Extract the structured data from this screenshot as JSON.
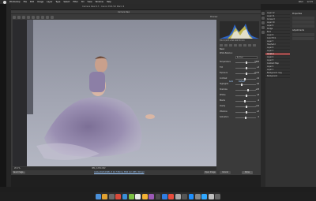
{
  "menubar": {
    "items": [
      "Photoshop",
      "File",
      "Edit",
      "Image",
      "Layer",
      "Type",
      "Select",
      "Filter",
      "3D",
      "View",
      "Window",
      "Help"
    ],
    "right": [
      "Wed",
      "12:15"
    ]
  },
  "ps": {
    "document_title": "Camera Raw 9.7 - Canon EOS 5D Mark III"
  },
  "acr": {
    "title": "Camera Raw",
    "preview_label": "Preview",
    "zoom": "20.1%",
    "filename": "IMG_1234.CR2",
    "footer_info": "Adobe RGB (1998); 8 bit; 5760 by 3840 (22.1MP); 300 ppi",
    "save_button": "Save Image...",
    "open_button": "Open Image",
    "cancel_button": "Cancel",
    "done_button": "Done"
  },
  "panel": {
    "camera_info": "f/4.0  1/125 s  ISO 400  50 mm",
    "header": "Basic",
    "white_balance_label": "White Balance:",
    "white_balance_value": "As Shot",
    "auto_link": "Auto",
    "default_link": "Default",
    "sliders": [
      {
        "label": "Temperature",
        "value": "5200",
        "pos": 0.55
      },
      {
        "label": "Tint",
        "value": "+4",
        "pos": 0.52
      },
      {
        "label": "Exposure",
        "value": "+0.35",
        "pos": 0.53
      },
      {
        "label": "Contrast",
        "value": "-12",
        "pos": 0.45
      },
      {
        "label": "Highlights",
        "value": "-40",
        "pos": 0.32
      },
      {
        "label": "Shadows",
        "value": "+25",
        "pos": 0.62
      },
      {
        "label": "Whites",
        "value": "+8",
        "pos": 0.54
      },
      {
        "label": "Blacks",
        "value": "-6",
        "pos": 0.48
      },
      {
        "label": "Clarity",
        "value": "+10",
        "pos": 0.55
      },
      {
        "label": "Vibrance",
        "value": "+5",
        "pos": 0.52
      },
      {
        "label": "Saturation",
        "value": "0",
        "pos": 0.5
      }
    ]
  },
  "layers_panel": {
    "items": [
      "Layer 12",
      "Layer 11",
      "Curves 3",
      "Layer 10",
      "Layer 9",
      "Dodge",
      "Burn",
      "Layer 8",
      "Color Fill 1",
      "Layer 7",
      "Hue/Sat 2",
      "Layer 6",
      "Layer 5",
      "Levels 1",
      "Layer 4",
      "Layer 3",
      "Gradient Map",
      "Layer 2",
      "Layer 1",
      "Background copy",
      "Background"
    ],
    "selected_red_index": 13,
    "selected_blue_index": 24
  },
  "props_panel": {
    "headers": [
      "Properties",
      "Adjustments"
    ]
  },
  "dock_colors": [
    "#4a90d9",
    "#e0a030",
    "#6a6a6a",
    "#d84a3a",
    "#3a8fd8",
    "#7bc043",
    "#e8e8e8",
    "#f2b134",
    "#9b59b6",
    "#4a4a4a",
    "#2f7de1",
    "#e74c3c",
    "#aaaaaa",
    "#555555",
    "#1e90ff",
    "#888888",
    "#31a8ff",
    "#c0c0c0",
    "#666666"
  ]
}
